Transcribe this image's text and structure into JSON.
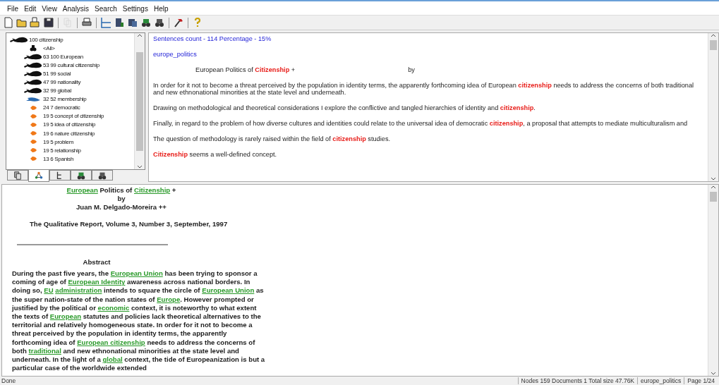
{
  "menu": [
    "File",
    "Edit",
    "View",
    "Analysis",
    "Search",
    "Settings",
    "Help"
  ],
  "toolbar": [
    {
      "kind": "new",
      "disabled": false
    },
    {
      "kind": "open",
      "disabled": false
    },
    {
      "kind": "open2",
      "disabled": false
    },
    {
      "kind": "save",
      "disabled": false
    },
    {
      "kind": "sep"
    },
    {
      "kind": "copy",
      "disabled": true
    },
    {
      "kind": "sep"
    },
    {
      "kind": "print",
      "disabled": false
    },
    {
      "kind": "sep"
    },
    {
      "kind": "tree",
      "disabled": false
    },
    {
      "kind": "doc",
      "disabled": false
    },
    {
      "kind": "docs",
      "disabled": false
    },
    {
      "kind": "binoc",
      "disabled": false
    },
    {
      "kind": "binoc2",
      "disabled": false
    },
    {
      "kind": "sep"
    },
    {
      "kind": "hammer",
      "disabled": false
    },
    {
      "kind": "sep"
    },
    {
      "kind": "help",
      "disabled": false
    }
  ],
  "tree": [
    {
      "label": "100 citizenship",
      "kind": "whale",
      "children": [
        {
          "label": "<All>",
          "kind": "all"
        },
        {
          "label": "63 100 European",
          "kind": "whale"
        },
        {
          "label": "53 99 cultural citizenship",
          "kind": "whale"
        },
        {
          "label": "51 99 social",
          "kind": "whale"
        },
        {
          "label": "47 99 nationality",
          "kind": "whale"
        },
        {
          "label": "32 99 global",
          "kind": "whale"
        },
        {
          "label": "32 52 membership",
          "kind": "dolphin"
        },
        {
          "label": "24 7 democratic",
          "kind": "fish"
        },
        {
          "label": "19 5 concept of citizenship",
          "kind": "fish"
        },
        {
          "label": "19 5 idea of citizenship",
          "kind": "fish"
        },
        {
          "label": "19 6 nature citizenship",
          "kind": "fish"
        },
        {
          "label": "19 5 problem",
          "kind": "fish"
        },
        {
          "label": "19 5 relationship",
          "kind": "fish"
        },
        {
          "label": "13 6 Spanish",
          "kind": "fish"
        }
      ]
    }
  ],
  "panel_tabs": [
    {
      "kind": "pages",
      "selected": false
    },
    {
      "kind": "network",
      "selected": true
    },
    {
      "kind": "tree",
      "selected": false
    },
    {
      "kind": "binoc",
      "selected": false
    },
    {
      "kind": "binoc2",
      "selected": false
    }
  ],
  "summary": {
    "stats": "Sentences count - 114  Percentage - 15%",
    "document": "europe_politics",
    "title": "European Politics of **Citizenship** +",
    "title_by": "by",
    "sentences": [
      "In order  for it not to become a threat perceived by the population in identity  terms, the apparently forthcoming idea of European **citizenship** needs to  address the concerns of both traditional and new ethnonational minorities  at the state level and underneath.",
      "Drawing on methodological and theoretical  considerations I explore the conflictive and tangled hierarchies of  identity and **citizenship**.",
      "Finally, in regard to the problem of how diverse  cultures and identities could relate to the universal idea of democratic  **citizenship**, a proposal that attempts to mediate multiculturalism and",
      "The question of methodology is rarely raised within the field of  **citizenship** studies.",
      "**Citizenship** seems a well-defined concept."
    ]
  },
  "document": {
    "title": [
      {
        "text": "European",
        "link": true
      },
      {
        "text": " Politics of ",
        "link": false
      },
      {
        "text": "Citizenship",
        "link": true
      },
      {
        "text": " +",
        "link": false
      }
    ],
    "by": "by",
    "author": "Juan M. Delgado-Moreira ++",
    "journal": "The Qualitative Report, Volume 3, Number 3, September, 1997",
    "abstract_heading": "Abstract",
    "abstract": [
      {
        "text": "During the past five years, the ",
        "link": false
      },
      {
        "text": "European Union",
        "link": true
      },
      {
        "text": " has been trying to sponsor a coming of age of ",
        "link": false
      },
      {
        "text": "European Identity",
        "link": true
      },
      {
        "text": " awareness across national borders. In doing so, ",
        "link": false
      },
      {
        "text": "EU",
        "link": true,
        "space_after": true
      },
      {
        "text": "administration",
        "link": true
      },
      {
        "text": " intends to square the circle of ",
        "link": false
      },
      {
        "text": "European Union",
        "link": true
      },
      {
        "text": " as the super nation-state of the nation states of ",
        "link": false
      },
      {
        "text": "Europe",
        "link": true
      },
      {
        "text": ". However prompted or justified by the political or ",
        "link": false
      },
      {
        "text": "economic",
        "link": true
      },
      {
        "text": " context, it is noteworthy to what extent the texts of ",
        "link": false
      },
      {
        "text": "European",
        "link": true
      },
      {
        "text": " statutes and policies lack theoretical alternatives to the territorial and relatively homogeneous state. In order for it not to become a threat perceived by the population in identity terms, the apparently forthcoming idea of ",
        "link": false
      },
      {
        "text": "European citizenship",
        "link": true
      },
      {
        "text": " needs to address the concerns of both ",
        "link": false
      },
      {
        "text": "traditional",
        "link": true
      },
      {
        "text": " and new ethnonational minorities at the state level and underneath. In the light of a ",
        "link": false
      },
      {
        "text": "global",
        "link": true
      },
      {
        "text": " context, the tide of Europeanization is but a particular case of the worldwide extended",
        "link": false
      }
    ]
  },
  "status_bar": {
    "message": "Done",
    "sections": [
      "Nodes 159  Documents 1  Total size 47.76K",
      "europe_politics",
      "Page 1/24"
    ]
  }
}
